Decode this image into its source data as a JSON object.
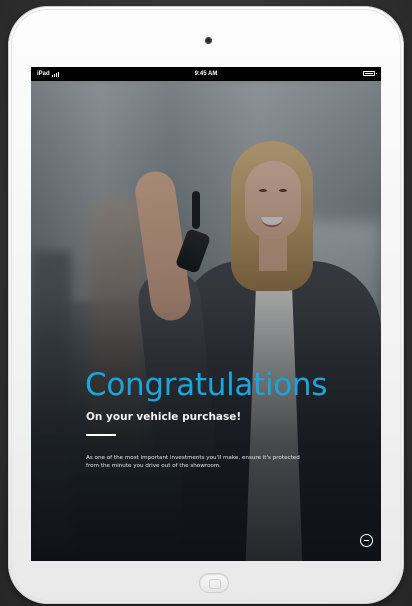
{
  "status_bar": {
    "carrier": "iPad",
    "time": "9:45 AM",
    "signal_icon": "wifi-signal-icon",
    "battery_icon": "battery-icon"
  },
  "hero": {
    "headline": "Congratulations",
    "subheadline": "On your vehicle purchase!",
    "body": "As one of the most important investments you'll make, ensure it's protected from the minute you drive out of the showroom.",
    "image_description_icon": "woman-with-car-keys-photo"
  },
  "menu": {
    "icon": "menu-icon"
  },
  "device": {
    "camera_icon": "camera-icon",
    "home_button_icon": "home-button-icon"
  },
  "colors": {
    "accent": "#1aa6dd",
    "text_light": "#f2f2f2",
    "background": "#3a3a3a"
  }
}
